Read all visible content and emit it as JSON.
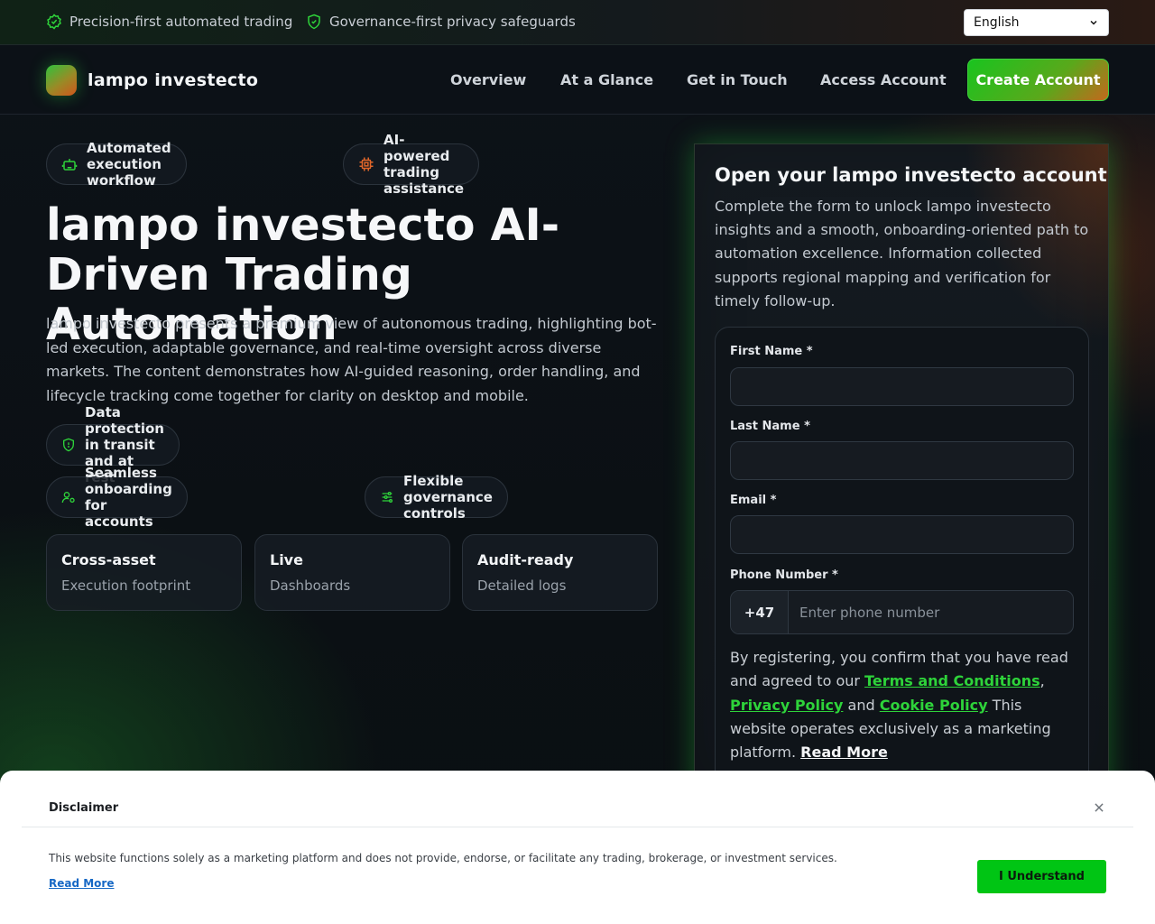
{
  "topbar": {
    "trust_items": [
      {
        "label": "Precision-first automated trading",
        "icon": "check-badge-icon"
      },
      {
        "label": "Governance-first privacy safeguards",
        "icon": "shield-icon"
      }
    ],
    "language": {
      "selected": "English"
    }
  },
  "nav": {
    "brand": "lampo investecto",
    "links": [
      "Overview",
      "At a Glance",
      "Get in Touch",
      "Access Account"
    ],
    "cta": "Create Account"
  },
  "hero": {
    "badges": [
      {
        "label": "Automated execution workflow",
        "icon": "robot-icon",
        "color": "#2ed33a"
      },
      {
        "label": "AI-powered trading assistance",
        "icon": "chip-icon",
        "color": "#e0662a"
      }
    ],
    "title": "lampo investecto AI-Driven Trading Automation",
    "description": "lampo investecto presents a premium view of autonomous trading, highlighting bot-led execution, adaptable governance, and real-time oversight across diverse markets. The content demonstrates how AI-guided reasoning, order handling, and lifecycle tracking come together for clarity on desktop and mobile.",
    "features": [
      {
        "label": "Data protection in transit and at rest",
        "icon": "shield-icon"
      },
      {
        "label": "Seamless onboarding for accounts",
        "icon": "user-gear-icon"
      },
      {
        "label": "Flexible governance controls",
        "icon": "sliders-icon"
      }
    ],
    "stats": [
      {
        "value": "Cross-asset",
        "label": "Execution footprint"
      },
      {
        "value": "Live",
        "label": "Dashboards"
      },
      {
        "value": "Audit-ready",
        "label": "Detailed logs"
      }
    ]
  },
  "form": {
    "title": "Open your lampo investecto account",
    "description": "Complete the form to unlock lampo investecto insights and a smooth, onboarding-oriented path to automation excellence. Information collected supports regional mapping and verification for timely follow-up.",
    "first_name_label": "First Name *",
    "first_name_value": "",
    "last_name_label": "Last Name *",
    "last_name_value": "",
    "email_label": "Email *",
    "email_value": "",
    "phone_label": "Phone Number *",
    "phone_code": "+47",
    "phone_placeholder": "Enter phone number",
    "legal": {
      "text1": "By registering, you confirm that you have read and agreed to our ",
      "terms": "Terms and Conditions",
      "comma": ",",
      "privacy": "Privacy Policy",
      "and": " and ",
      "cookie": "Cookie Policy",
      "text2": " This website operates exclusively as a marketing platform. ",
      "read_more": "Read More"
    }
  },
  "disclaimer": {
    "title": "Disclaimer",
    "text": "This website functions solely as a marketing platform and does not provide, endorse, or facilitate any trading, brokerage, or investment services.",
    "read_more": "Read More",
    "button": "I Understand"
  },
  "colors": {
    "accent_green": "#2ed33a",
    "accent_orange": "#e0662a",
    "button_green": "#00c514"
  }
}
